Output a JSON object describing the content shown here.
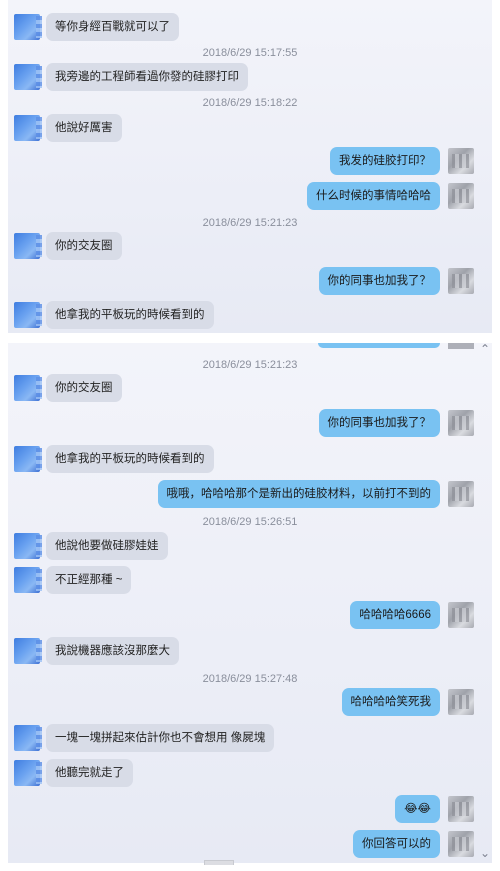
{
  "top": {
    "timestamps": [
      "2018/6/29 15:17:55",
      "2018/6/29 15:18:22",
      "2018/6/29 15:21:23"
    ],
    "messages": [
      {
        "side": "left",
        "text": "等你身經百戰就可以了"
      },
      {
        "side": "left",
        "text": "我旁邊的工程師看過你發的硅膠打印"
      },
      {
        "side": "left",
        "text": "他說好厲害"
      },
      {
        "side": "right",
        "text": "我发的硅胶打印？"
      },
      {
        "side": "right",
        "text": "什么时候的事情哈哈哈"
      },
      {
        "side": "left",
        "text": "你的交友圈"
      },
      {
        "side": "right",
        "text": "你的同事也加我了？"
      },
      {
        "side": "left",
        "text": "他拿我的平板玩的時候看到的"
      }
    ]
  },
  "bottom": {
    "timestamps": [
      "2018/6/29 15:21:23",
      "2018/6/29 15:26:51",
      "2018/6/29 15:27:48"
    ],
    "messages": [
      {
        "side": "left",
        "text": "你的交友圈"
      },
      {
        "side": "right",
        "text": "你的同事也加我了？"
      },
      {
        "side": "left",
        "text": "他拿我的平板玩的時候看到的"
      },
      {
        "side": "right",
        "text": "哦哦，哈哈哈那个是新出的硅胶材料，以前打不到的"
      },
      {
        "side": "left",
        "text": "他說他要做硅膠娃娃"
      },
      {
        "side": "left",
        "text": "不正經那種 ~"
      },
      {
        "side": "right",
        "text": "哈哈哈哈6666"
      },
      {
        "side": "left",
        "text": "我說機器應該沒那麼大"
      },
      {
        "side": "right",
        "text": "哈哈哈哈笑死我"
      },
      {
        "side": "left",
        "text": "一塊一塊拼起來估計你也不會想用 像屍塊"
      },
      {
        "side": "left",
        "text": "他聽完就走了"
      },
      {
        "side": "right",
        "text": "😂😂"
      },
      {
        "side": "right",
        "text": "你回答可以的"
      }
    ]
  },
  "icons": {
    "scroll_up": "chevron-up-icon",
    "scroll_down": "chevron-down-icon"
  },
  "colors": {
    "sent_bubble": "#79c2f2",
    "received_bubble": "#d8dce7",
    "timestamp": "#8a8f9c"
  }
}
